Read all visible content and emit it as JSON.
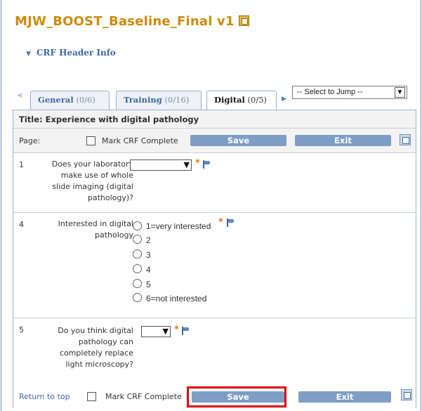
{
  "header": {
    "title": "MJW_BOOST_Baseline_Final v1",
    "crf_header_label": "CRF Header Info"
  },
  "tabs": [
    {
      "label": "General",
      "count": "(0/6)",
      "active": false
    },
    {
      "label": "Training",
      "count": "(0/16)",
      "active": false
    },
    {
      "label": "Digital",
      "count": "(0/5)",
      "active": true
    }
  ],
  "jump_select": {
    "value": "-- Select to Jump --"
  },
  "section": {
    "title": "Title: Experience with digital pathology"
  },
  "page_bar": {
    "page_label": "Page:",
    "mark_complete": "Mark CRF Complete",
    "save": "Save",
    "exit": "Exit"
  },
  "questions": [
    {
      "number": "1",
      "lines": [
        "Does your laboratory",
        "make use of whole",
        "slide imaging (digital",
        "pathology)?"
      ],
      "type": "select",
      "value": ""
    },
    {
      "number": "4",
      "lines": [
        "Interested in digital",
        "pathology"
      ],
      "type": "radio",
      "options": [
        "1=very interested",
        "2",
        "3",
        "4",
        "5",
        "6=not interested"
      ]
    },
    {
      "number": "5",
      "lines": [
        "Do you think digital",
        "pathology can",
        "completely replace",
        "light microscopy?"
      ],
      "type": "select",
      "value": ""
    }
  ],
  "footer": {
    "return_to_top": "Return to top",
    "mark_complete": "Mark CRF Complete",
    "save": "Save",
    "exit": "Exit"
  },
  "colors": {
    "title": "#d08a0a",
    "link": "#3c68a8",
    "button": "#7f9ec6",
    "required": "#e1771d",
    "highlight": "#e00000"
  },
  "icons": [
    "crf-document-icon",
    "expand-triangle-icon",
    "tab-scroll-left-icon",
    "tab-scroll-right-icon",
    "dropdown-arrow-icon",
    "required-asterisk",
    "flag-icon",
    "print-icon"
  ]
}
